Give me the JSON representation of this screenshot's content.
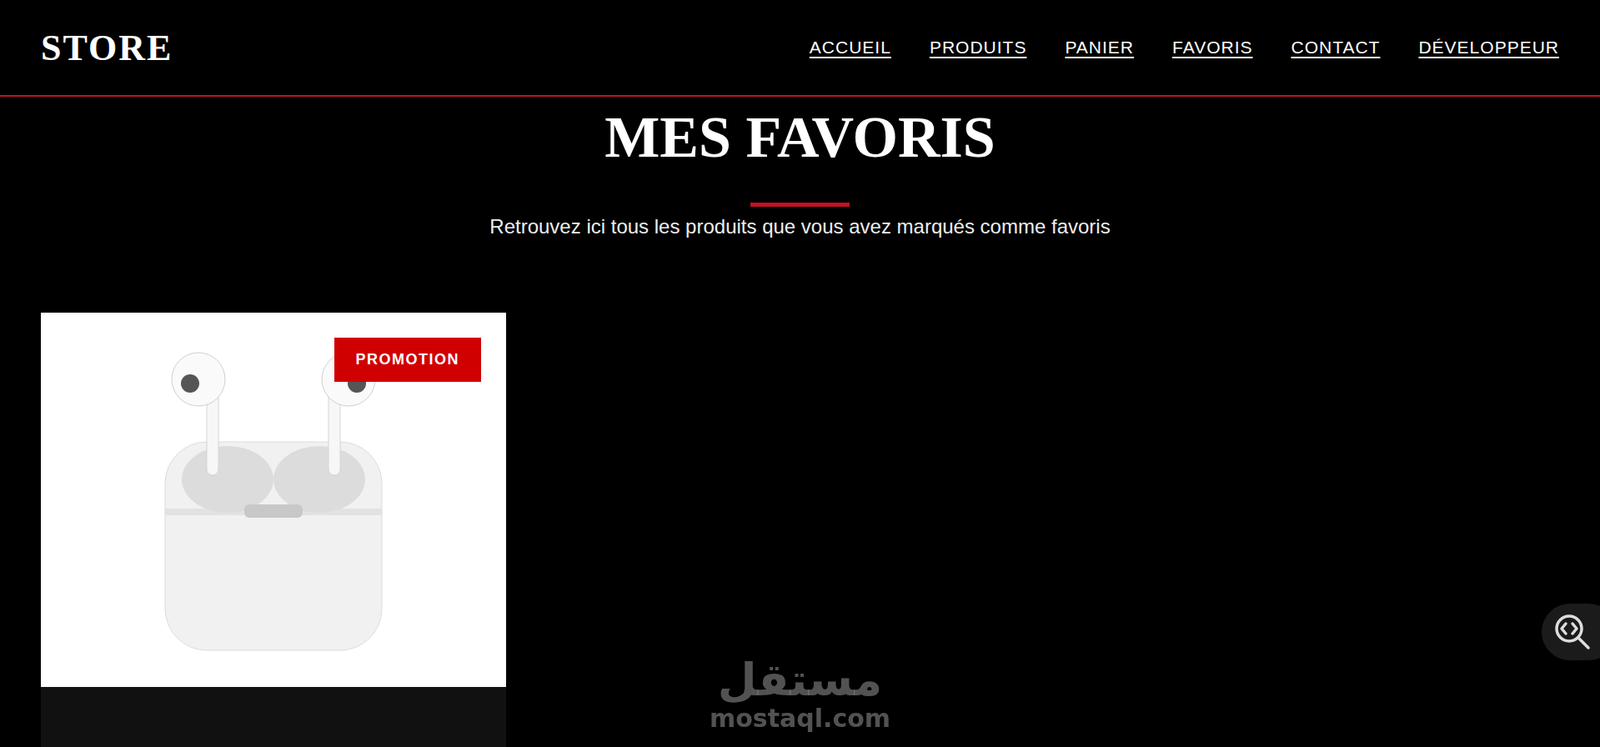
{
  "header": {
    "logo": "STORE",
    "nav": [
      {
        "label": "ACCUEIL"
      },
      {
        "label": "PRODUITS"
      },
      {
        "label": "PANIER"
      },
      {
        "label": "FAVORIS"
      },
      {
        "label": "CONTACT"
      },
      {
        "label": "DÉVELOPPEUR"
      }
    ]
  },
  "page": {
    "title": "MES FAVORIS",
    "subtitle": "Retrouvez ici tous les produits que vous avez marqués comme favoris"
  },
  "favorites": [
    {
      "badge": "PROMOTION"
    }
  ],
  "watermark": {
    "arabic": "مستقل",
    "latin": "mostaql.com"
  }
}
